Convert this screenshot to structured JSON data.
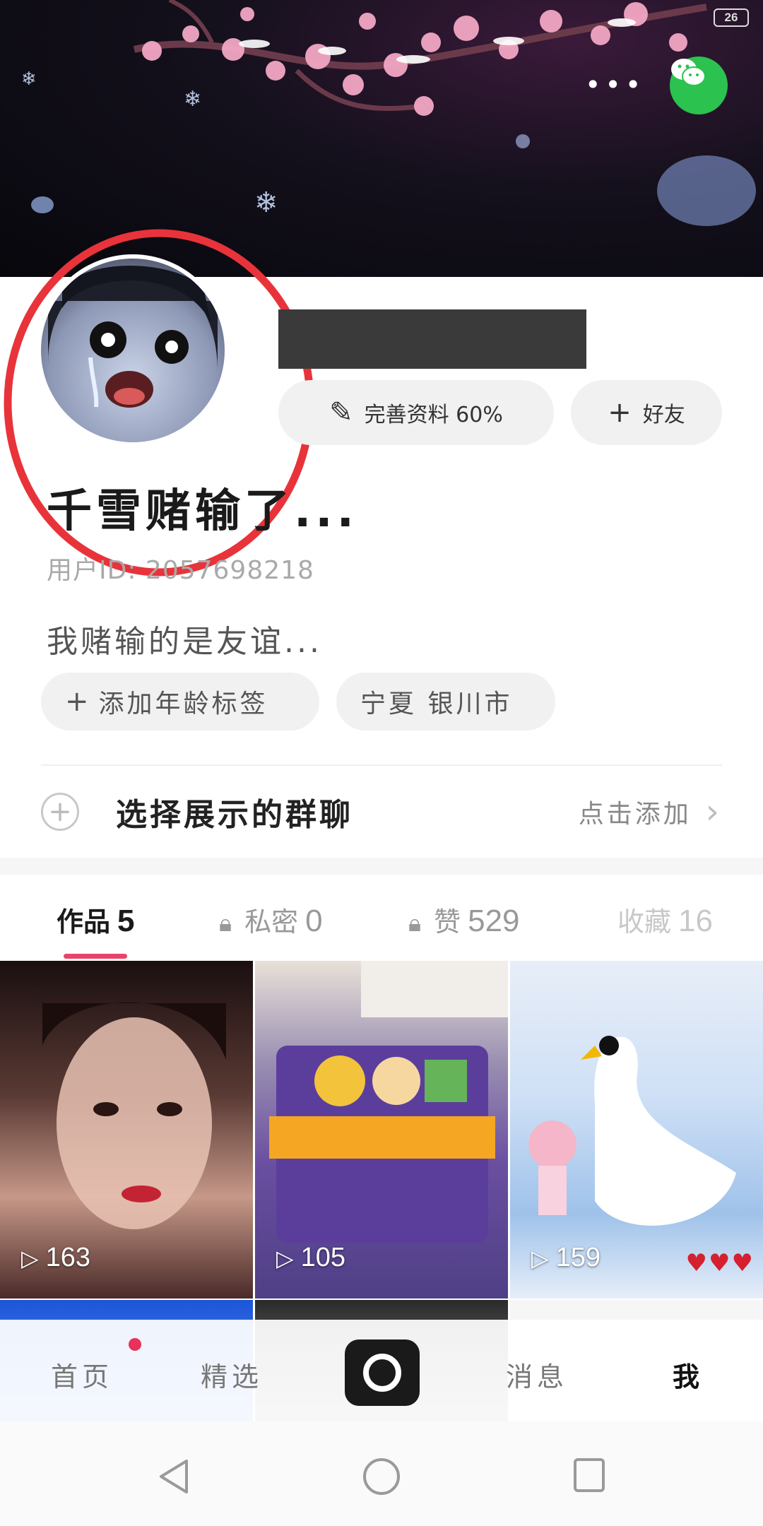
{
  "status_bar": {
    "battery": "26"
  },
  "cover": {
    "more_label": "•••"
  },
  "profile": {
    "nickname": "千雪赌输了...",
    "user_id": "用户ID: 2057698218",
    "bio": "我赌输的是友谊...",
    "complete_profile_label": "完善资料 60%",
    "add_friend_label": "好友",
    "tags": [
      {
        "label": "添加年龄标签"
      },
      {
        "label": "宁夏 银川市"
      }
    ]
  },
  "group_chat": {
    "label": "选择展示的群聊",
    "action": "点击添加"
  },
  "tabs": [
    {
      "label": "作品",
      "count": "5"
    },
    {
      "label": "私密",
      "count": "0"
    },
    {
      "label": "赞",
      "count": "529"
    },
    {
      "label": "收藏",
      "count": "16"
    }
  ],
  "videos": [
    {
      "views": "163"
    },
    {
      "views": "105"
    },
    {
      "views": "159"
    }
  ],
  "bottom_nav": {
    "home": "首页",
    "featured": "精选",
    "messages": "消息",
    "me": "我"
  },
  "colors": {
    "accent": "#e8436b",
    "wechat": "#2bc24f",
    "annotation_circle": "#e8333a"
  }
}
